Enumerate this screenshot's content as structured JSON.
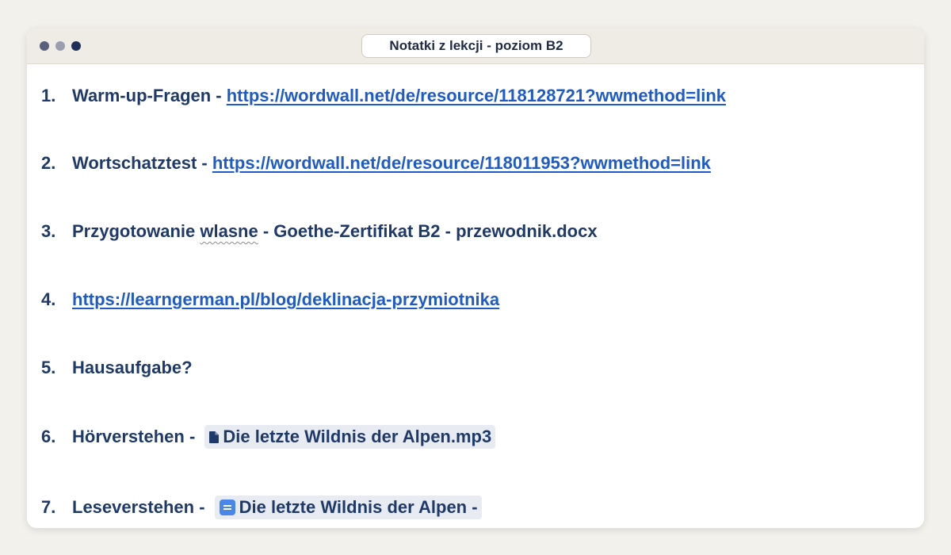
{
  "window": {
    "title": "Notatki z lekcji - poziom B2"
  },
  "colors": {
    "text": "#1f3a68",
    "link": "#1f5bc6",
    "chip_bg": "#e8ebf2",
    "titlebar_bg": "#efece5"
  },
  "items": [
    {
      "num": "1.",
      "text": "Warm-up-Fragen - ",
      "link": "https://wordwall.net/de/resource/118128721?wwmethod=link"
    },
    {
      "num": "2.",
      "text": "Wortschatztest - ",
      "link": "https://wordwall.net/de/resource/118011953?wwmethod=link"
    },
    {
      "num": "3.",
      "text_a": "Przygotowanie ",
      "text_misspelled": "wlasne",
      "text_b": " - Goethe-Zertifikat B2 - przewodnik.docx"
    },
    {
      "num": "4.",
      "link": "https://learngerman.pl/blog/deklinacja-przymiotnika"
    },
    {
      "num": "5.",
      "text": "Hausaufgabe?"
    },
    {
      "num": "6.",
      "text": "Hörverstehen - ",
      "chip": {
        "icon": "file-icon",
        "label": "Die letzte Wildnis der Alpen.mp3"
      }
    },
    {
      "num": "7.",
      "text": "Leseverstehen - ",
      "chip": {
        "icon": "docs-icon",
        "label": "Die letzte Wildnis der Alpen -"
      }
    }
  ]
}
